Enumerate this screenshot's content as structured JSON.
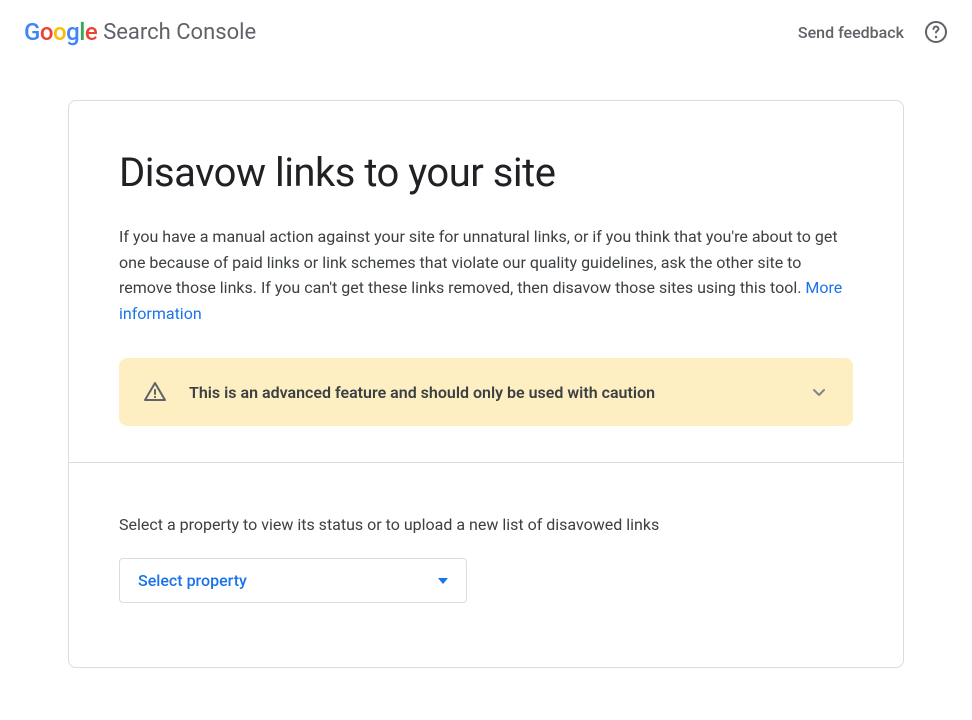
{
  "header": {
    "logo": {
      "g1": "G",
      "g2": "o",
      "g3": "o",
      "g4": "g",
      "g5": "l",
      "g6": "e"
    },
    "product_name": "Search Console",
    "feedback": "Send feedback"
  },
  "main": {
    "title": "Disavow links to your site",
    "description": "If you have a manual action against your site for unnatural links, or if you think that you're about to get one because of paid links or link schemes that violate our quality guidelines, ask the other site to remove those links. If you can't get these links removed, then disavow those sites using this tool. ",
    "more_info": "More information",
    "warning": "This is an advanced feature and should only be used with caution",
    "select_label": "Select a property to view its status or to upload a new list of disavowed links",
    "select_placeholder": "Select property"
  }
}
